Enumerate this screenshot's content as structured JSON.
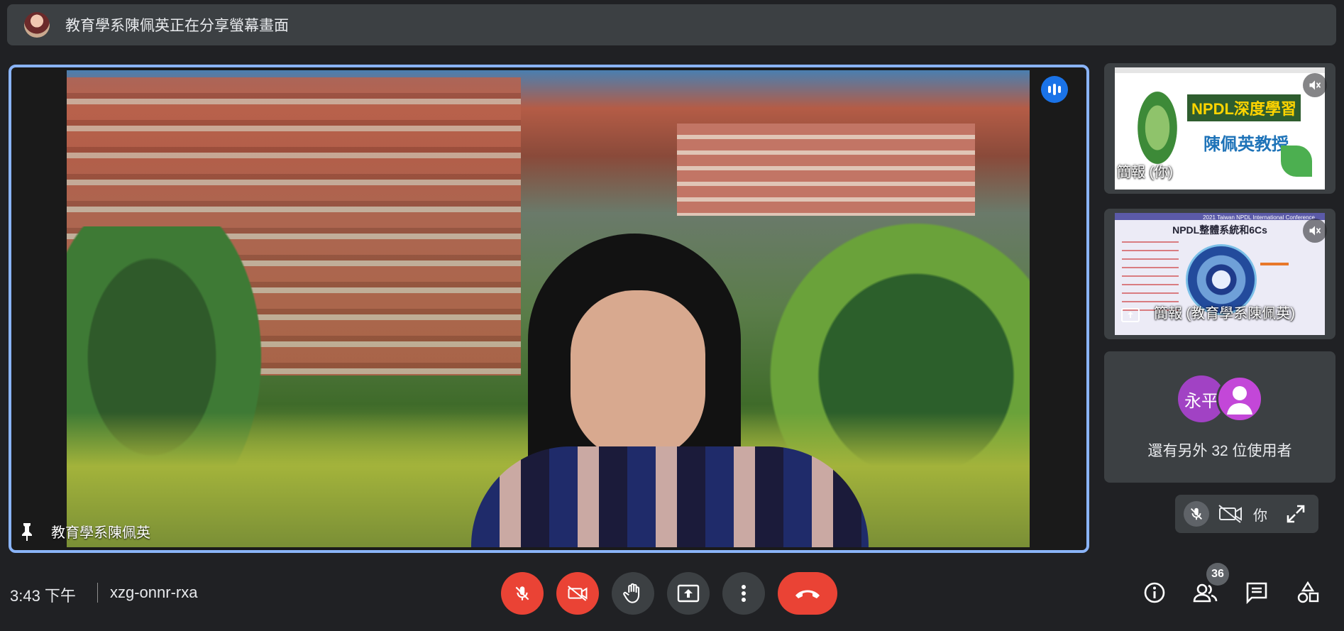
{
  "banner": {
    "text": "教育學系陳佩英正在分享螢幕畫面"
  },
  "main": {
    "speaker_name": "教育學系陳佩英"
  },
  "side_tiles": {
    "presentation_self": {
      "label": "簡報 (你)",
      "slide_title": "NPDL深度學習",
      "slide_subtitle": "陳佩英教授"
    },
    "presentation_presenter": {
      "label": "簡報 (教育學系陳佩英)",
      "slide_header": "2021 Taiwan NPDL International Conference",
      "slide_title": "NPDL整體系統和6Cs"
    },
    "others": {
      "avatar_text": "永平",
      "count_text": "還有另外 32 位使用者"
    }
  },
  "self_view": {
    "label": "你"
  },
  "bottom_bar": {
    "time": "3:43 下午",
    "meeting_code": "xzg-onnr-rxa",
    "participant_count": "36"
  },
  "colors": {
    "accent": "#8ab4f8",
    "speaking": "#1a73e8",
    "danger": "#ea4335",
    "surface": "#3c4043",
    "background": "#202124"
  }
}
